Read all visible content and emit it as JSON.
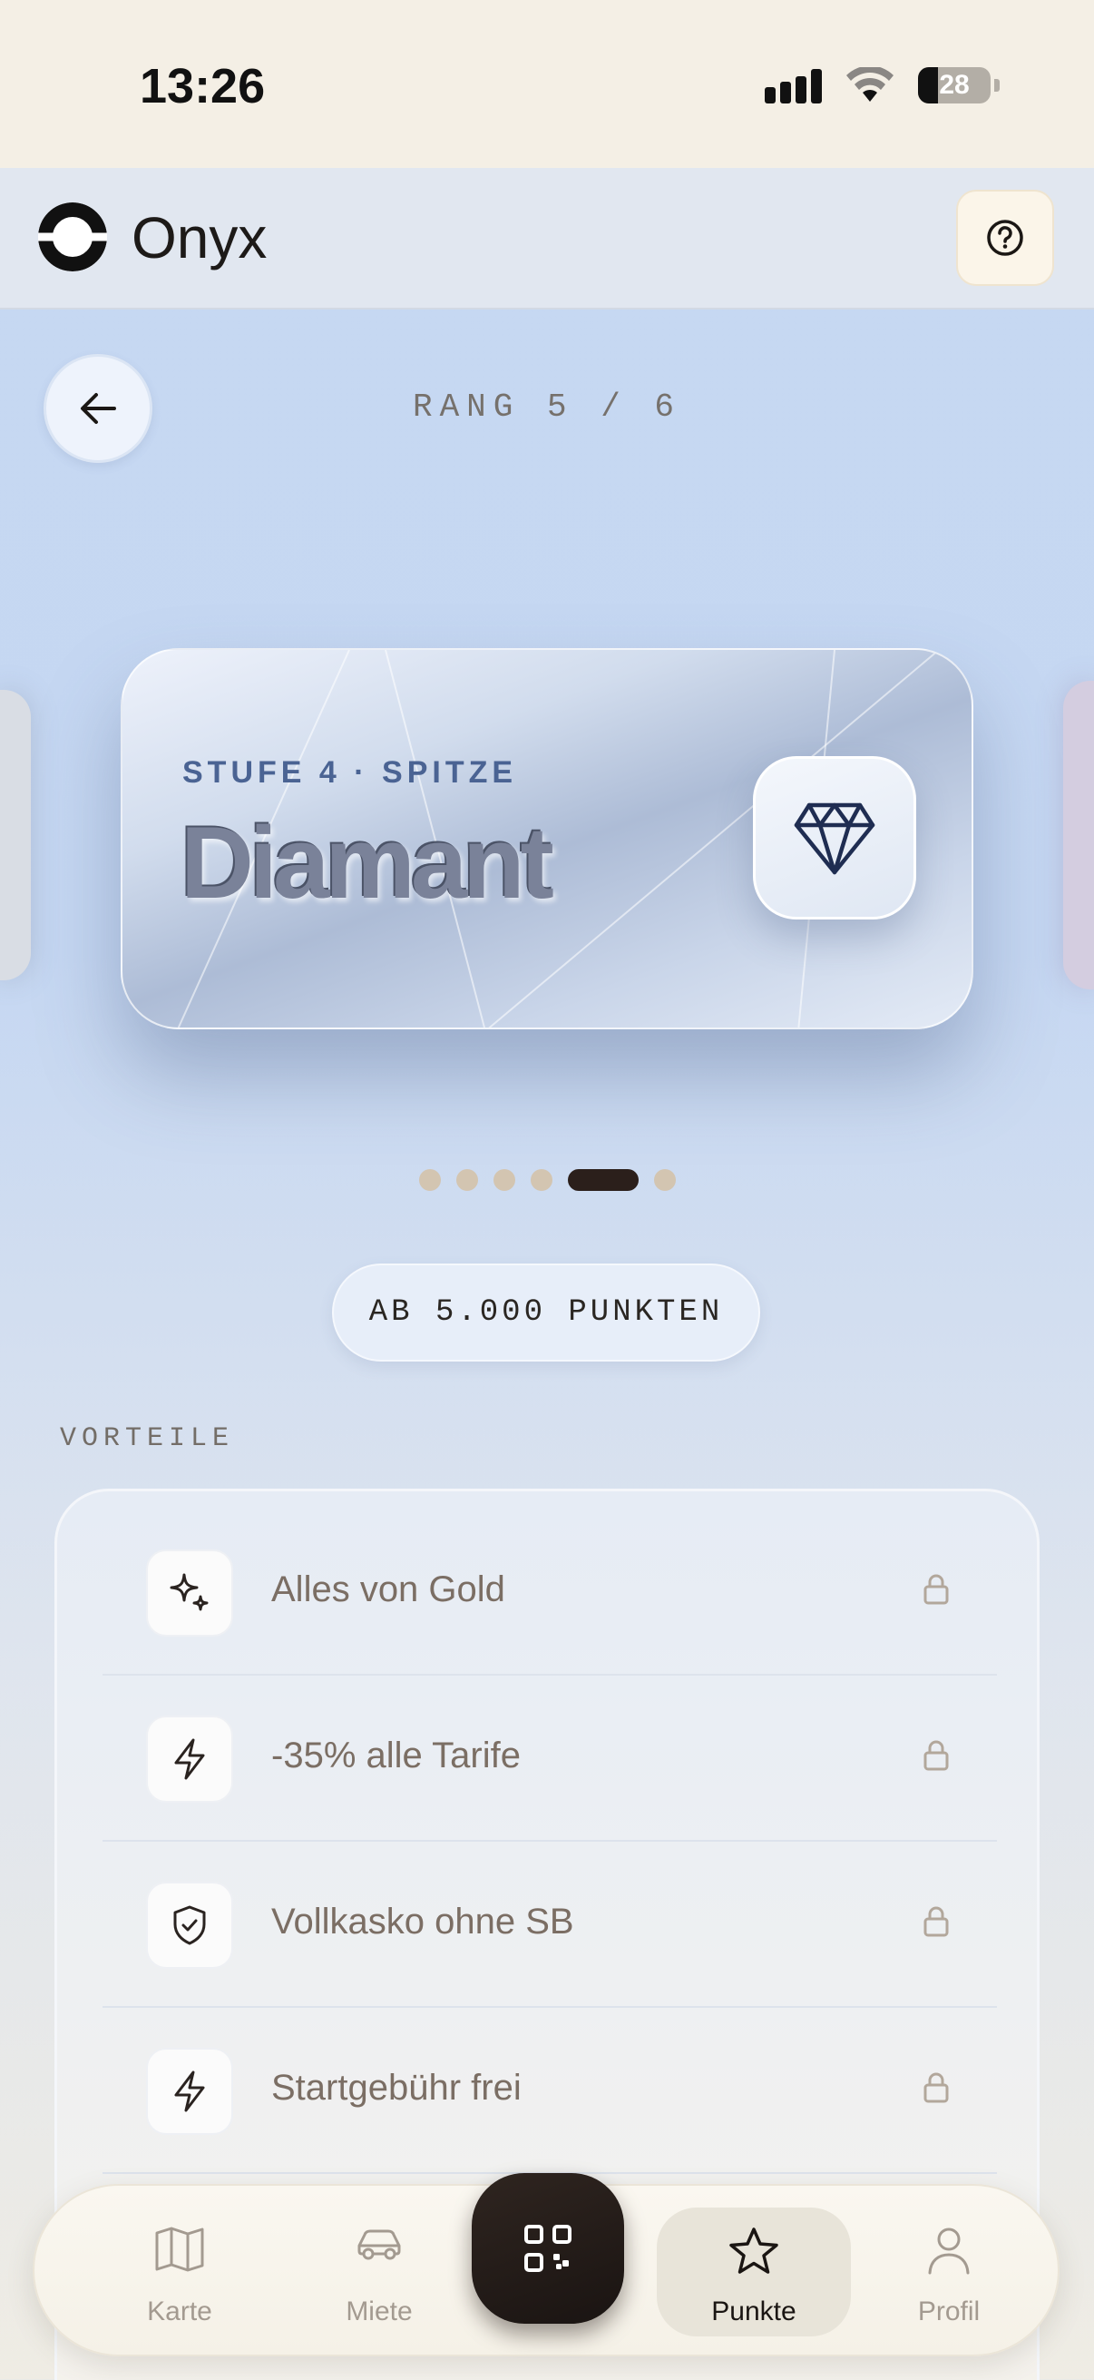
{
  "status_bar": {
    "time": "13:26",
    "battery": "28"
  },
  "header": {
    "brand": "Onyx"
  },
  "tier": {
    "rank_label": "RANG 5 / 6",
    "subtitle": "STUFE 4 · SPITZE",
    "name": "Diamant",
    "icon": "diamond-icon",
    "pagination": {
      "total": 6,
      "active_index": 4
    },
    "points_label": "AB 5.000 PUNKTEN"
  },
  "benefits": {
    "section_label": "VORTEILE",
    "items": [
      {
        "label": "Alles von Gold",
        "icon": "sparkles-icon",
        "locked": true
      },
      {
        "label": "-35% alle Tarife",
        "icon": "lightning-icon",
        "locked": true
      },
      {
        "label": "Vollkasko ohne SB",
        "icon": "shield-check-icon",
        "locked": true
      },
      {
        "label": "Startgebühr frei",
        "icon": "lightning-icon",
        "locked": true
      }
    ]
  },
  "nav": {
    "items": [
      {
        "label": "Karte",
        "icon": "map-icon"
      },
      {
        "label": "Miete",
        "icon": "car-icon"
      },
      {
        "label": "Punkte",
        "icon": "star-icon",
        "active": true
      },
      {
        "label": "Profil",
        "icon": "user-icon"
      }
    ],
    "center": {
      "icon": "qr-code-icon"
    }
  },
  "colors": {
    "accent_dark": "#2b1f1b",
    "tier_text": "#4a6393",
    "background_blue": "#c6d8f2"
  }
}
